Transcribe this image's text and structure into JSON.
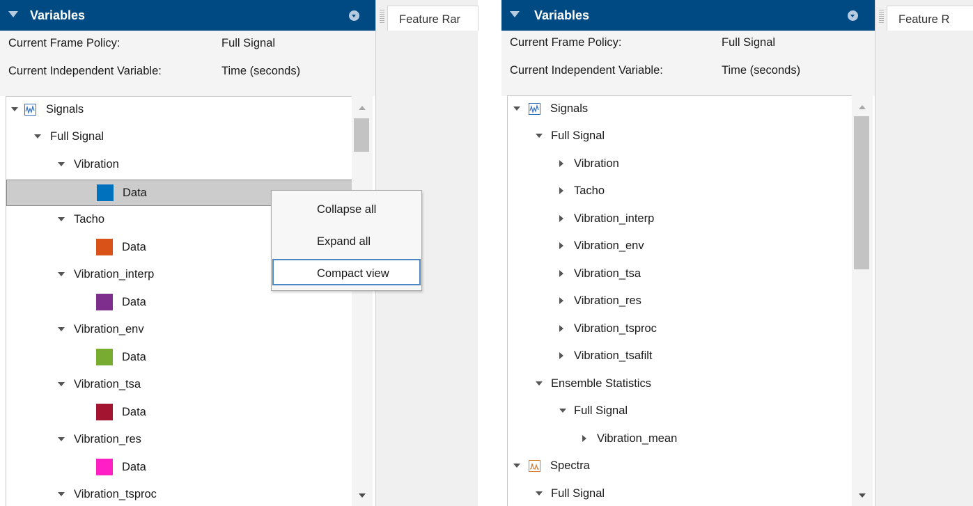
{
  "left": {
    "title": "Variables",
    "frame_policy_label": "Current Frame Policy:",
    "frame_policy_value": "Full Signal",
    "indep_var_label": "Current Independent Variable:",
    "indep_var_value": "Time (seconds)",
    "tab_label": "Feature Rar",
    "tree": [
      {
        "label": "Signals"
      },
      {
        "label": "Full Signal"
      },
      {
        "label": "Vibration"
      },
      {
        "label": "Data",
        "color": "#0072bd"
      },
      {
        "label": "Tacho"
      },
      {
        "label": "Data",
        "color": "#d95319"
      },
      {
        "label": "Vibration_interp"
      },
      {
        "label": "Data",
        "color": "#7e2f8e"
      },
      {
        "label": "Vibration_env"
      },
      {
        "label": "Data",
        "color": "#77ac30"
      },
      {
        "label": "Vibration_tsa"
      },
      {
        "label": "Data",
        "color": "#a2142f"
      },
      {
        "label": "Vibration_res"
      },
      {
        "label": "Data",
        "color": "#ff1fc4"
      },
      {
        "label": "Vibration_tsproc"
      }
    ],
    "context_menu": [
      "Collapse all",
      "Expand all",
      "Compact view"
    ]
  },
  "right": {
    "title": "Variables",
    "frame_policy_label": "Current Frame Policy:",
    "frame_policy_value": "Full Signal",
    "indep_var_label": "Current Independent Variable:",
    "indep_var_value": "Time (seconds)",
    "tab_label": "Feature R",
    "tree": [
      {
        "label": "Signals"
      },
      {
        "label": "Full Signal"
      },
      {
        "label": "Vibration"
      },
      {
        "label": "Tacho"
      },
      {
        "label": "Vibration_interp"
      },
      {
        "label": "Vibration_env"
      },
      {
        "label": "Vibration_tsa"
      },
      {
        "label": "Vibration_res"
      },
      {
        "label": "Vibration_tsproc"
      },
      {
        "label": "Vibration_tsafilt"
      },
      {
        "label": "Ensemble Statistics"
      },
      {
        "label": "Full Signal"
      },
      {
        "label": "Vibration_mean"
      },
      {
        "label": "Spectra"
      },
      {
        "label": "Full Signal"
      }
    ]
  },
  "colors": {
    "titlebar": "#004a84",
    "selection": "#cccccc",
    "menu_focus": "#4b87c5"
  }
}
